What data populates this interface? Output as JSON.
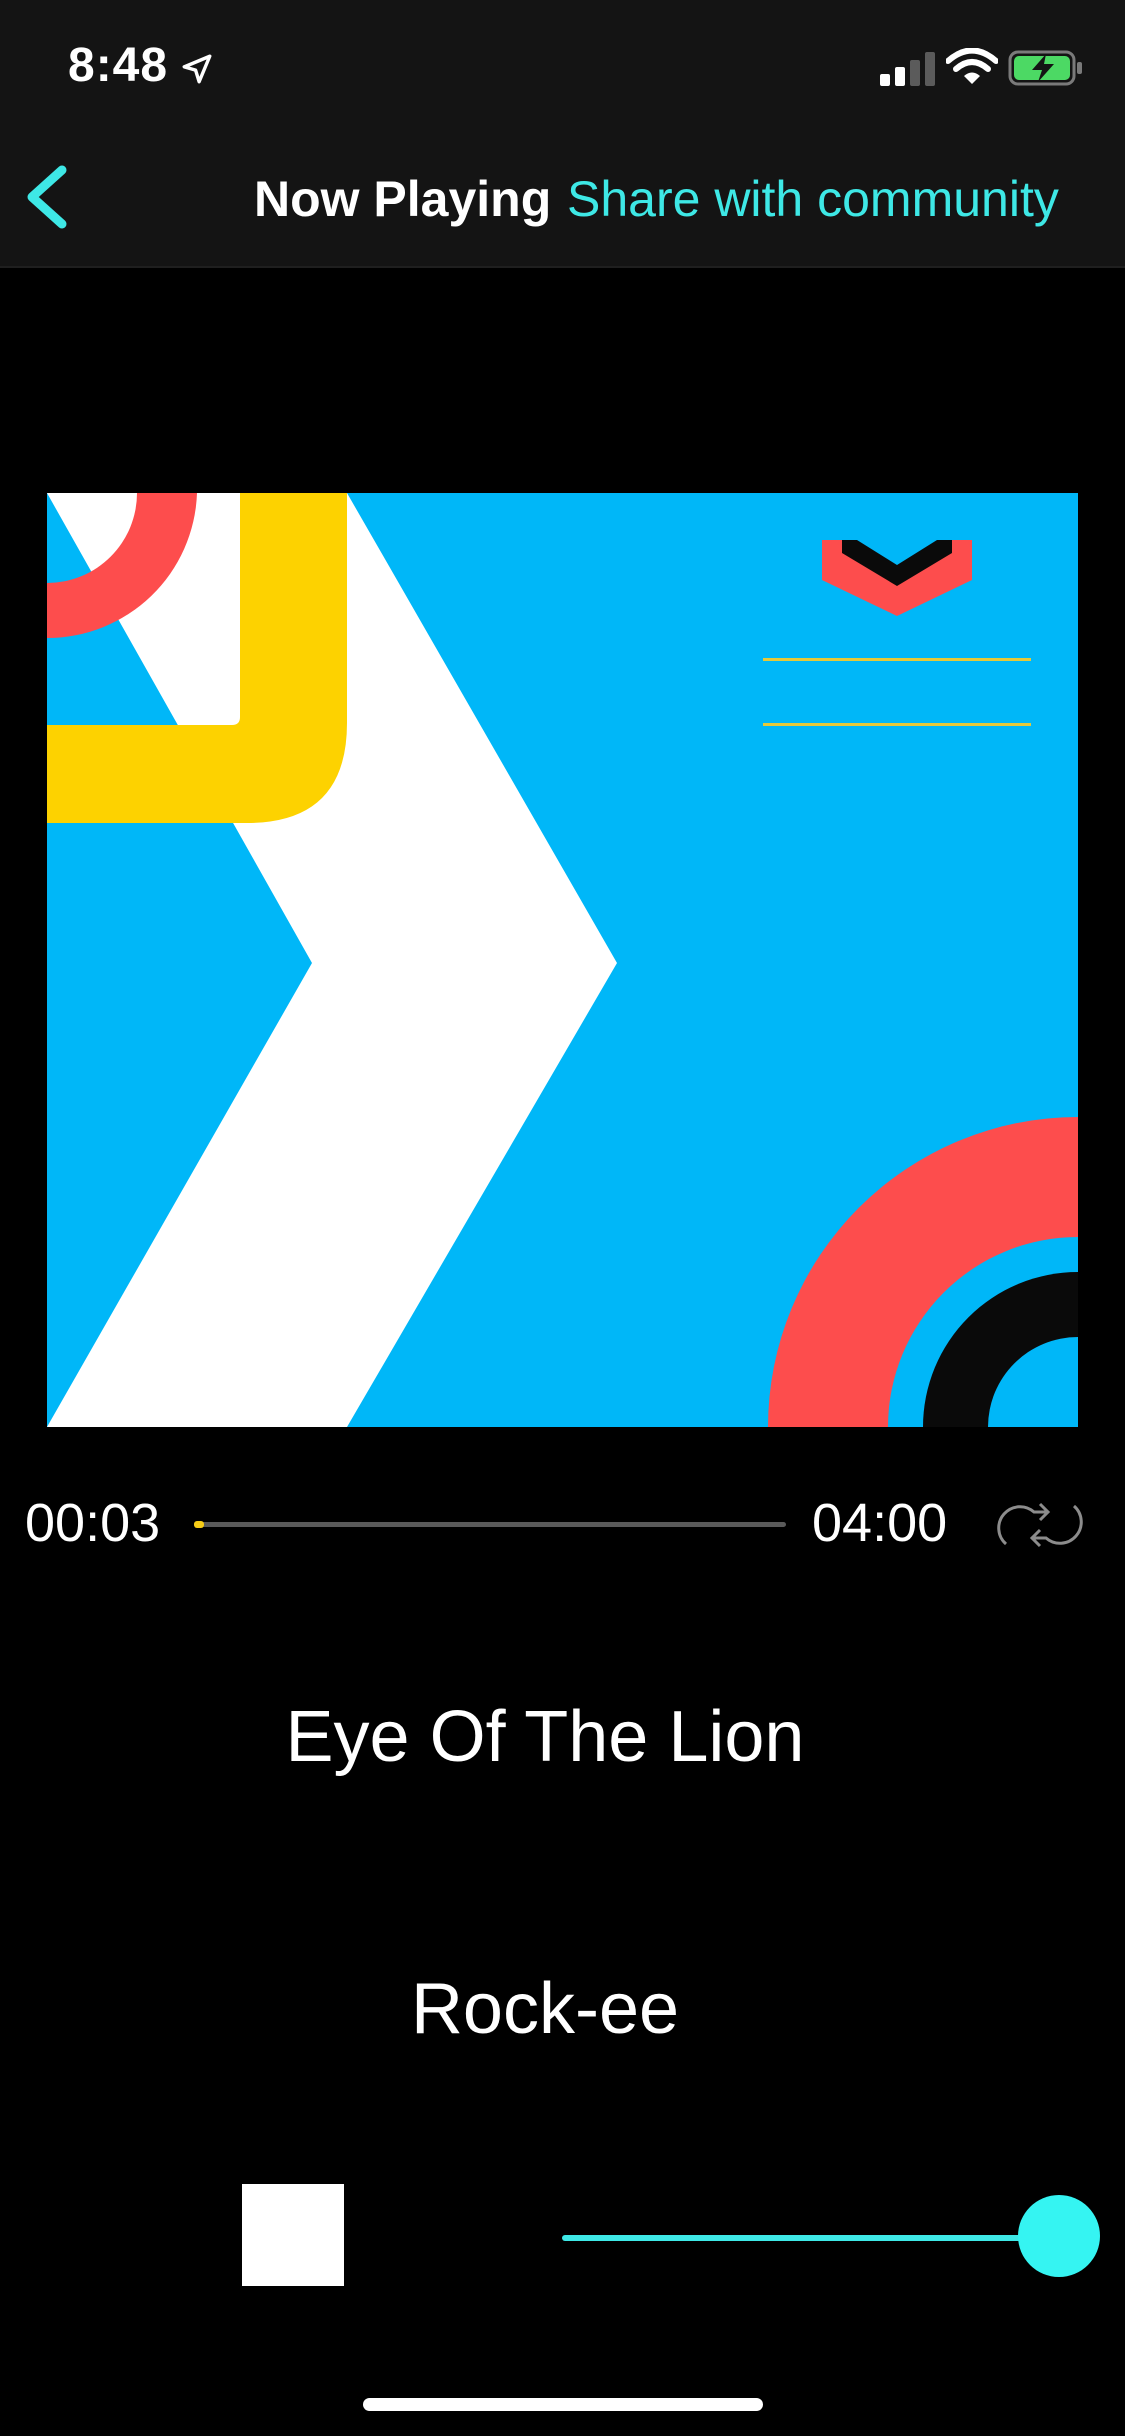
{
  "status_bar": {
    "time": "8:48",
    "location_icon": "location-arrow-icon",
    "signal_icon": "cellular-signal-icon",
    "wifi_icon": "wifi-icon",
    "battery_icon": "battery-charging-icon"
  },
  "nav": {
    "back_icon": "chevron-left-icon",
    "title": "Now Playing",
    "share_label": "Share with community"
  },
  "player": {
    "elapsed": "00:03",
    "total": "04:00",
    "progress_fraction": 0.011,
    "repeat_icon": "repeat-icon",
    "song_title": "Eye Of The Lion",
    "artist": "Rock-ee",
    "stop_icon": "stop-icon",
    "volume_fraction": 1.0
  },
  "colors": {
    "accent": "#3ee8e6",
    "progress": "#f6cc16",
    "art_background": "#00b7f8",
    "art_red": "#fd4d4d",
    "art_yellow": "#fdd200"
  }
}
